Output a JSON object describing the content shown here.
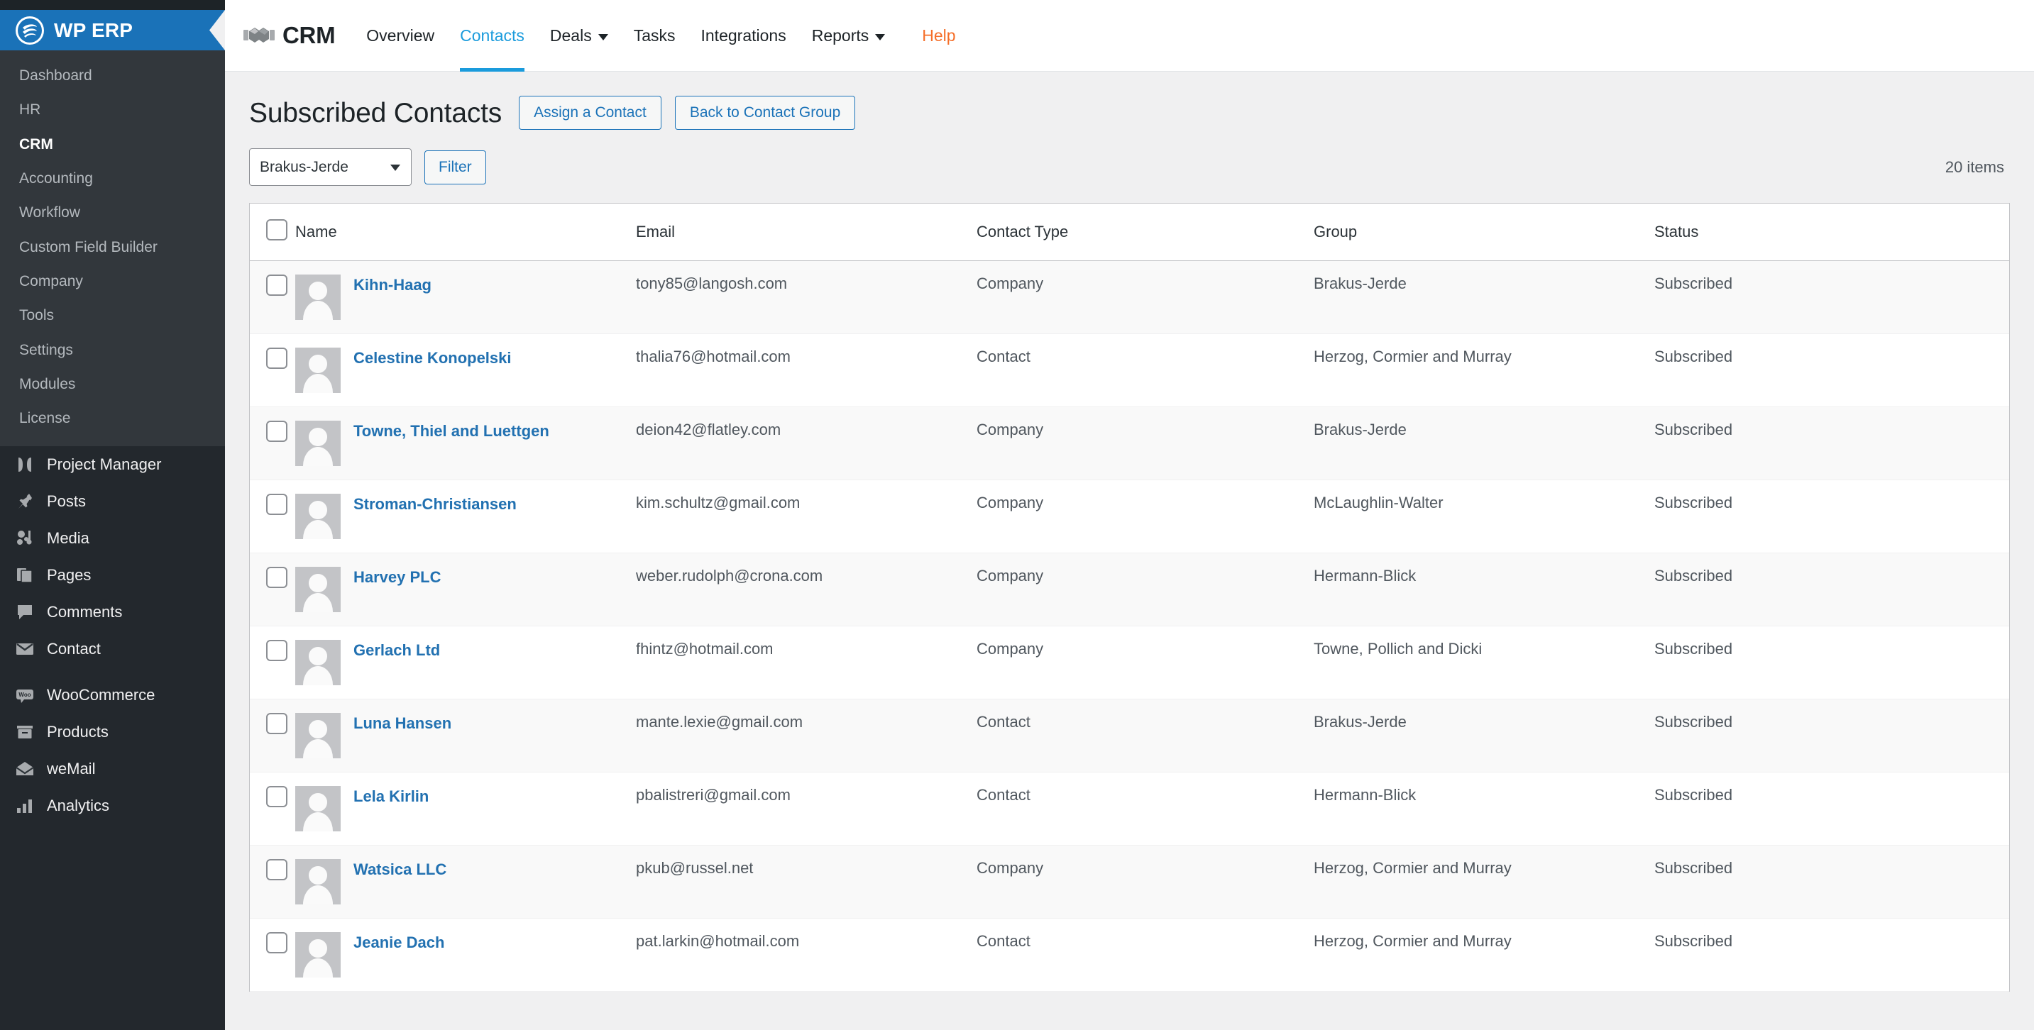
{
  "sidebar": {
    "brand": {
      "label": "WP ERP",
      "logo_icon": "wperp-logo-icon",
      "accent": "#1a72b8"
    },
    "submenu": [
      {
        "label": "Dashboard",
        "current": false
      },
      {
        "label": "HR",
        "current": false
      },
      {
        "label": "CRM",
        "current": true
      },
      {
        "label": "Accounting",
        "current": false
      },
      {
        "label": "Workflow",
        "current": false
      },
      {
        "label": "Custom Field Builder",
        "current": false
      },
      {
        "label": "Company",
        "current": false
      },
      {
        "label": "Tools",
        "current": false
      },
      {
        "label": "Settings",
        "current": false
      },
      {
        "label": "Modules",
        "current": false
      },
      {
        "label": "License",
        "current": false
      }
    ],
    "menu": [
      {
        "label": "Project Manager",
        "icon": "project-manager-icon"
      },
      {
        "label": "Posts",
        "icon": "pin-icon"
      },
      {
        "label": "Media",
        "icon": "media-icon"
      },
      {
        "label": "Pages",
        "icon": "pages-icon"
      },
      {
        "label": "Comments",
        "icon": "comment-icon"
      },
      {
        "label": "Contact",
        "icon": "envelope-icon"
      },
      {
        "label": "WooCommerce",
        "icon": "woocommerce-icon"
      },
      {
        "label": "Products",
        "icon": "products-icon"
      },
      {
        "label": "weMail",
        "icon": "wemail-icon"
      },
      {
        "label": "Analytics",
        "icon": "analytics-icon"
      }
    ]
  },
  "crm_nav": {
    "logo_icon": "handshake-icon",
    "title": "CRM",
    "items": [
      {
        "label": "Overview",
        "active": false,
        "chevron": false,
        "help": false
      },
      {
        "label": "Contacts",
        "active": true,
        "chevron": false,
        "help": false
      },
      {
        "label": "Deals",
        "active": false,
        "chevron": true,
        "help": false
      },
      {
        "label": "Tasks",
        "active": false,
        "chevron": false,
        "help": false
      },
      {
        "label": "Integrations",
        "active": false,
        "chevron": false,
        "help": false
      },
      {
        "label": "Reports",
        "active": false,
        "chevron": true,
        "help": false
      },
      {
        "label": "Help",
        "active": false,
        "chevron": false,
        "help": true
      }
    ],
    "active_color": "#1a9bdc",
    "help_color": "#f56e28"
  },
  "page": {
    "title": "Subscribed Contacts",
    "assign_button": "Assign a Contact",
    "back_button": "Back to Contact Group",
    "group_filter_value": "Brakus-Jerde",
    "filter_button": "Filter",
    "items_count": "20 items"
  },
  "table": {
    "columns": [
      "Name",
      "Email",
      "Contact Type",
      "Group",
      "Status"
    ],
    "rows": [
      {
        "name": "Kihn-Haag",
        "email": "tony85@langosh.com",
        "type": "Company",
        "group": "Brakus-Jerde",
        "status": "Subscribed"
      },
      {
        "name": "Celestine Konopelski",
        "email": "thalia76@hotmail.com",
        "type": "Contact",
        "group": "Herzog, Cormier and Murray",
        "status": "Subscribed"
      },
      {
        "name": "Towne, Thiel and Luettgen",
        "email": "deion42@flatley.com",
        "type": "Company",
        "group": "Brakus-Jerde",
        "status": "Subscribed"
      },
      {
        "name": "Stroman-Christiansen",
        "email": "kim.schultz@gmail.com",
        "type": "Company",
        "group": "McLaughlin-Walter",
        "status": "Subscribed"
      },
      {
        "name": "Harvey PLC",
        "email": "weber.rudolph@crona.com",
        "type": "Company",
        "group": "Hermann-Blick",
        "status": "Subscribed"
      },
      {
        "name": "Gerlach Ltd",
        "email": "fhintz@hotmail.com",
        "type": "Company",
        "group": "Towne, Pollich and Dicki",
        "status": "Subscribed"
      },
      {
        "name": "Luna Hansen",
        "email": "mante.lexie@gmail.com",
        "type": "Contact",
        "group": "Brakus-Jerde",
        "status": "Subscribed"
      },
      {
        "name": "Lela Kirlin",
        "email": "pbalistreri@gmail.com",
        "type": "Contact",
        "group": "Hermann-Blick",
        "status": "Subscribed"
      },
      {
        "name": "Watsica LLC",
        "email": "pkub@russel.net",
        "type": "Company",
        "group": "Herzog, Cormier and Murray",
        "status": "Subscribed"
      },
      {
        "name": "Jeanie Dach",
        "email": "pat.larkin@hotmail.com",
        "type": "Contact",
        "group": "Herzog, Cormier and Murray",
        "status": "Subscribed"
      }
    ]
  }
}
